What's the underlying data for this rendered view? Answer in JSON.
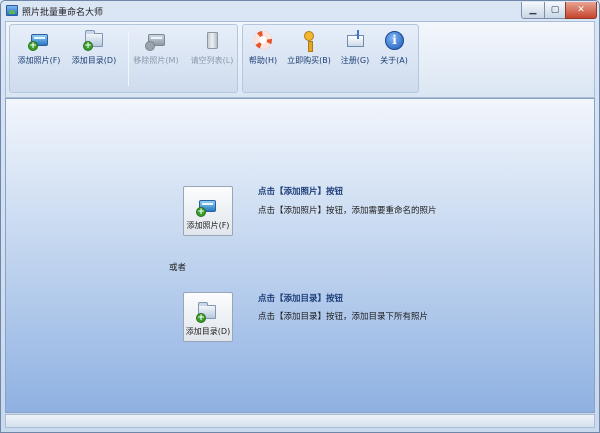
{
  "window": {
    "title": "照片批量重命名大师"
  },
  "toolbar": {
    "add_photo": "添加照片(F)",
    "add_dir": "添加目录(D)",
    "remove_photo": "移除照片(M)",
    "clear_list": "请空列表(L)",
    "help": "帮助(H)",
    "buy": "立即购买(B)",
    "register": "注册(G)",
    "about": "关于(A)"
  },
  "icons": {
    "add_photo": "photo-card-plus-icon",
    "add_dir": "folder-plus-icon",
    "remove_photo": "photo-card-minus-icon",
    "clear_list": "trash-can-icon",
    "help": "lifebuoy-icon",
    "buy": "key-icon",
    "register": "mail-icon",
    "about": "info-icon"
  },
  "main": {
    "add_photo_button": "添加照片(F)",
    "add_photo_title": "点击【添加照片】按钮",
    "add_photo_desc": "点击【添加照片】按钮，添加需要重命名的照片",
    "or_text": "或者",
    "add_dir_button": "添加目录(D)",
    "add_dir_title": "点击【添加目录】按钮",
    "add_dir_desc": "点击【添加目录】按钮，添加目录下所有照片"
  },
  "colors": {
    "accent": "#1d3f7a",
    "close_button": "#c6452c",
    "background_gradient_end": "#8fb1e2"
  }
}
